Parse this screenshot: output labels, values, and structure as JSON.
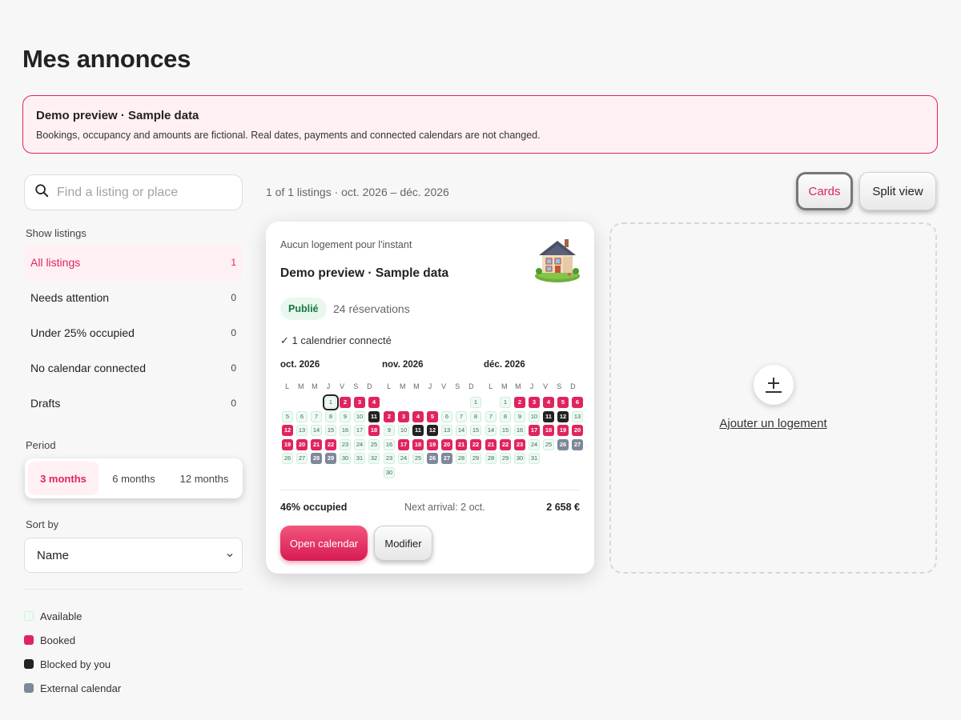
{
  "page": {
    "title": "Mes annonces"
  },
  "banner": {
    "title": "Demo preview · Sample data",
    "text": "Bookings, occupancy and amounts are fictional. Real dates, payments and connected calendars are not changed."
  },
  "search": {
    "placeholder": "Find a listing or place"
  },
  "filters": {
    "label": "Show listings",
    "items": [
      {
        "label": "All listings",
        "count": "1",
        "active": true
      },
      {
        "label": "Needs attention",
        "count": "0"
      },
      {
        "label": "Under 25% occupied",
        "count": "0"
      },
      {
        "label": "No calendar connected",
        "count": "0"
      },
      {
        "label": "Drafts",
        "count": "0"
      }
    ]
  },
  "period": {
    "label": "Period",
    "options": [
      {
        "label": "3 months",
        "active": true
      },
      {
        "label": "6 months"
      },
      {
        "label": "12 months"
      }
    ]
  },
  "sort": {
    "label": "Sort by",
    "value": "Name"
  },
  "legend": [
    {
      "label": "Available",
      "color": "#eefaf2"
    },
    {
      "label": "Booked",
      "color": "#e0245e"
    },
    {
      "label": "Blocked by you",
      "color": "#222222"
    },
    {
      "label": "External calendar",
      "color": "#7d889a"
    }
  ],
  "toolbar": {
    "listing_count": "1 of 1 listings · oct. 2026 – déc. 2026",
    "cards_label": "Cards",
    "split_label": "Split view"
  },
  "listing": {
    "subtitle": "Aucun logement pour l'instant",
    "title": "Demo preview · Sample data",
    "status": "Publié",
    "bookings": "24 réservations",
    "calendar_connected": "✓ 1 calendrier connecté",
    "occupied": "46% occupied",
    "next_arrival": "Next arrival: 2 oct.",
    "amount": "2 658 €",
    "open_calendar": "Open calendar",
    "modify": "Modifier",
    "weekdays": [
      "L",
      "M",
      "M",
      "J",
      "V",
      "S",
      "D"
    ],
    "months": [
      {
        "title": "oct. 2026",
        "offset": 3,
        "today": 1,
        "days": [
          "a",
          "b",
          "b",
          "b",
          "a",
          "a",
          "a",
          "a",
          "a",
          "a",
          "k",
          "b",
          "a",
          "a",
          "a",
          "a",
          "a",
          "b",
          "b",
          "b",
          "b",
          "b",
          "a",
          "a",
          "a",
          "a",
          "a",
          "x",
          "x",
          "a",
          "a",
          "a"
        ]
      },
      {
        "title": "nov. 2026",
        "offset": 6,
        "days": [
          "a",
          "b",
          "b",
          "b",
          "b",
          "a",
          "a",
          "a",
          "a",
          "a",
          "k",
          "k",
          "a",
          "a",
          "a",
          "a",
          "b",
          "b",
          "b",
          "b",
          "b",
          "b",
          "a",
          "a",
          "a",
          "x",
          "x",
          "a",
          "a",
          "a"
        ]
      },
      {
        "title": "déc. 2026",
        "offset": 1,
        "days": [
          "a",
          "b",
          "b",
          "b",
          "b",
          "b",
          "a",
          "a",
          "a",
          "a",
          "k",
          "k",
          "a",
          "a",
          "a",
          "a",
          "b",
          "b",
          "b",
          "b",
          "b",
          "b",
          "b",
          "a",
          "a",
          "x",
          "x",
          "a",
          "a",
          "a",
          "a"
        ]
      }
    ]
  },
  "add_listing": {
    "label": "Ajouter un logement"
  },
  "colors": {
    "accent": "#e0245e",
    "available": "#eefaf2",
    "booked": "#e0245e",
    "blocked": "#222222",
    "external": "#7d889a"
  }
}
